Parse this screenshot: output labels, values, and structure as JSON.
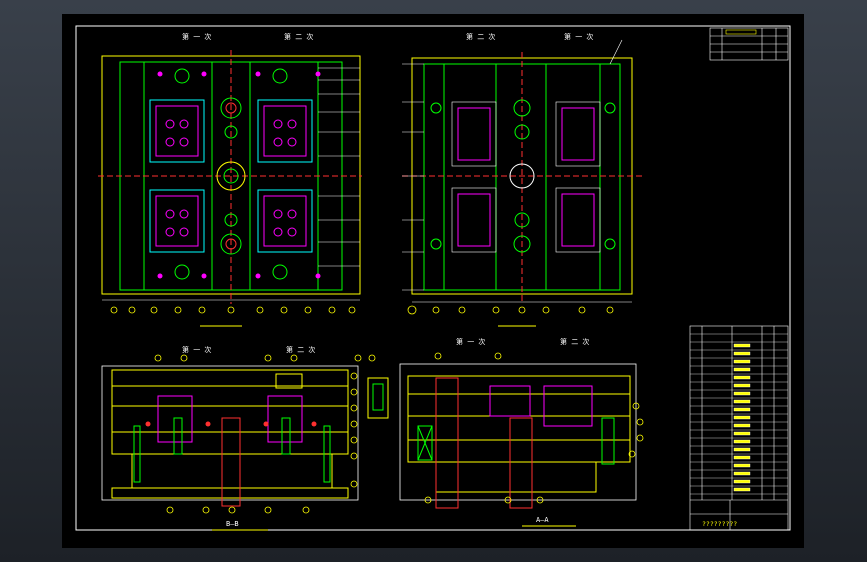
{
  "window": {
    "title": "",
    "background": "#2b3037"
  },
  "drawing": {
    "plan_left": {
      "first_mold_label": "第 一 次",
      "second_mold_label": "第 二 次"
    },
    "plan_right": {
      "second_mold_label": "第 二 次",
      "first_mold_label": "第 一 次"
    },
    "section_bb": {
      "first_mold_label": "第 一 次",
      "second_mold_label": "第 二 次",
      "section_label": "B—B"
    },
    "section_aa": {
      "first_mold_label": "第 一 次",
      "second_mold_label": "第 二 次",
      "section_label": "A—A"
    },
    "title_block": {
      "footer_text": "?????????"
    },
    "colors": {
      "frame": "#ffffff",
      "mold_outline": "#ffff00",
      "plate": "#00ff00",
      "center_line": "#ff3030",
      "cavity": "#ff00ff",
      "insert": "#00ffff",
      "dim": "#ffffff",
      "hidden": "#3060ff"
    }
  }
}
